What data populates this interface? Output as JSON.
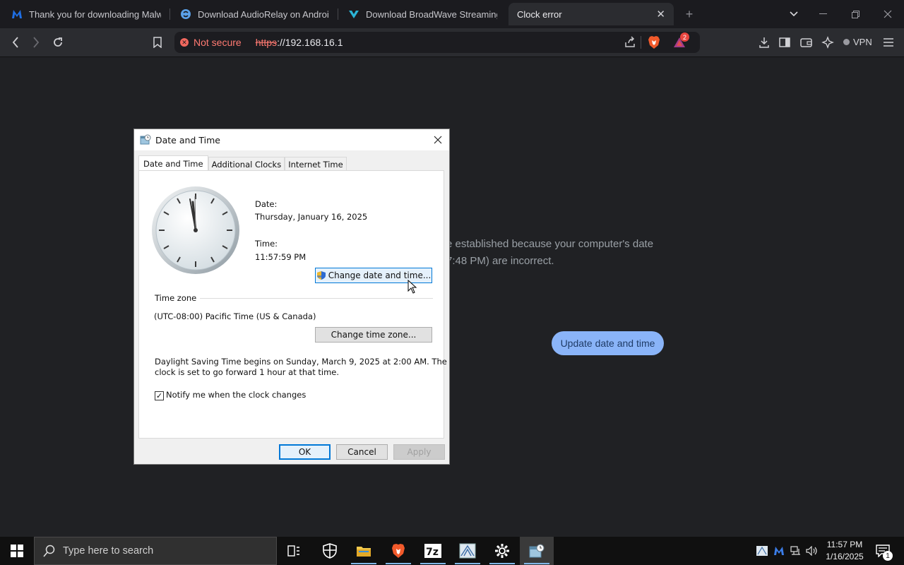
{
  "tabs": [
    {
      "title": "Thank you for downloading Malwar",
      "icon": "malwarebytes-icon"
    },
    {
      "title": "Download AudioRelay on Android, l",
      "icon": "audiorelay-icon"
    },
    {
      "title": "Download BroadWave Streaming Au",
      "icon": "broadwave-icon"
    },
    {
      "title": "Clock error",
      "icon": ""
    }
  ],
  "new_tab_symbol": "+",
  "address": {
    "security_label": "Not secure",
    "scheme": "https",
    "rest": "://192.168.16.1"
  },
  "badge_count": "2",
  "vpn_label": "VPN",
  "page": {
    "error_line1": "e established because your computer's date",
    "error_line2": "7:48 PM) are incorrect.",
    "update_button": "Update date and time"
  },
  "dialog": {
    "title": "Date and Time",
    "tabs": [
      "Date and Time",
      "Additional Clocks",
      "Internet Time"
    ],
    "date_label": "Date:",
    "date_value": "Thursday, January 16, 2025",
    "time_label": "Time:",
    "time_value": "11:57:59 PM",
    "change_datetime_button": "Change date and time...",
    "timezone_label": "Time zone",
    "timezone_value": "(UTC-08:00) Pacific Time (US & Canada)",
    "change_timezone_button": "Change time zone...",
    "dst_line1": "Daylight Saving Time begins on Sunday, March 9, 2025 at 2:00 AM. The",
    "dst_line2": "clock is set to go forward 1 hour at that time.",
    "notify_label": "Notify me when the clock changes",
    "notify_checked": true,
    "ok_button": "OK",
    "cancel_button": "Cancel",
    "apply_button": "Apply"
  },
  "taskbar": {
    "search_placeholder": "Type here to search",
    "time": "11:57 PM",
    "date": "1/16/2025",
    "notification_count": "1"
  },
  "colors": {
    "accent_blue": "#8ab4f8",
    "not_secure_red": "#f1685e",
    "page_bg": "#202124"
  }
}
